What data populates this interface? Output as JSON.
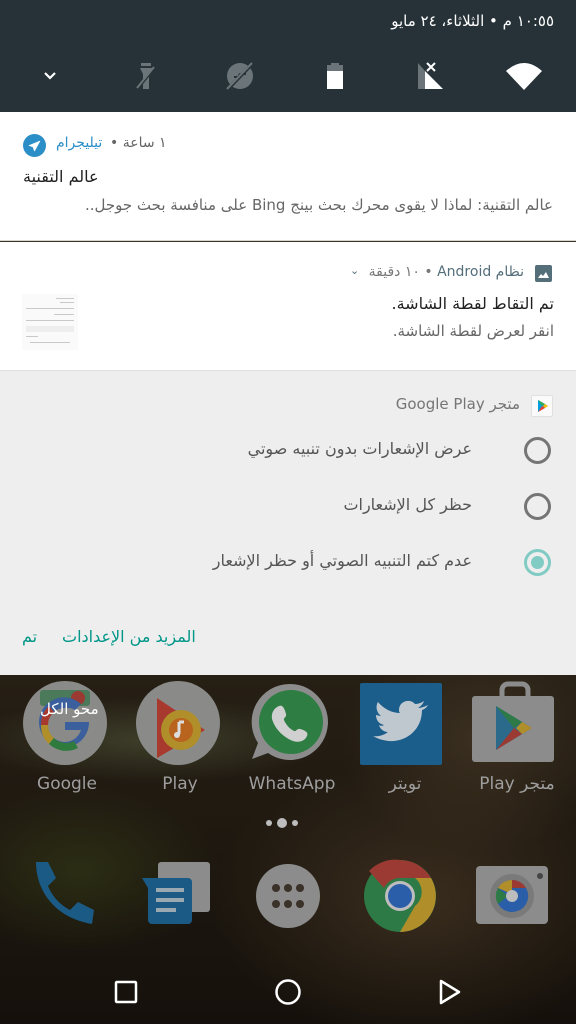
{
  "status": {
    "datetime": "١٠:٥٥ م • الثلاثاء، ٢٤ مايو"
  },
  "quick_settings": [
    {
      "name": "expand",
      "icon": "chevron-down-icon",
      "state": "enabled"
    },
    {
      "name": "flashlight",
      "icon": "flashlight-off-icon",
      "state": "off"
    },
    {
      "name": "auto-rotate",
      "icon": "rotation-off-icon",
      "state": "off"
    },
    {
      "name": "battery",
      "icon": "battery-icon",
      "state": "on"
    },
    {
      "name": "cellular",
      "icon": "signal-no-sim-icon",
      "state": "off"
    },
    {
      "name": "wifi",
      "icon": "wifi-icon",
      "state": "on"
    }
  ],
  "notifications": [
    {
      "app": "تيليجرام",
      "meta": "١ ساعة •",
      "title": "عالم التقنية",
      "body": "عالم التقنية: لماذا لا يقوى محرك بحث بينج Bing على منافسة بحث جوجل..",
      "accent": "#2b8ec7"
    },
    {
      "app": "نظام Android",
      "meta": "• ١٠ دقيقة",
      "title": "تم التقاط لقطة الشاشة.",
      "body": "انقر لعرض لقطة الشاشة.",
      "accent": "#546e7a"
    }
  ],
  "blocking": {
    "app": "متجر Google Play",
    "options": [
      {
        "label": "عرض الإشعارات بدون تنبيه صوتي",
        "selected": false
      },
      {
        "label": "حظر كل الإشعارات",
        "selected": false
      },
      {
        "label": "عدم كتم التنبيه الصوتي أو حظر الإشعار",
        "selected": true
      }
    ],
    "more_settings": "المزيد من الإعدادات",
    "done": "تم",
    "accent": "#009688"
  },
  "home": {
    "clear_all": "محو الكل",
    "apps": [
      {
        "label": "Google",
        "icon": "google-icon"
      },
      {
        "label": "Play",
        "icon": "play-music-icon"
      },
      {
        "label": "WhatsApp",
        "icon": "whatsapp-icon"
      },
      {
        "label": "تويتر",
        "icon": "twitter-icon"
      },
      {
        "label": "متجر Play",
        "icon": "play-store-icon"
      }
    ],
    "page_indicator": {
      "pages": 3,
      "current": 2
    },
    "dock": [
      "phone-icon",
      "messages-icon",
      "app-drawer-icon",
      "chrome-icon",
      "camera-icon"
    ]
  },
  "navbar": [
    "recents-button",
    "home-button",
    "back-button"
  ]
}
